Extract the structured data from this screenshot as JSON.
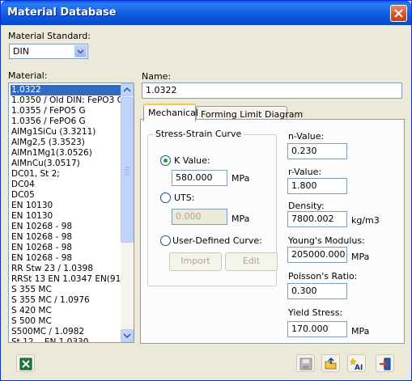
{
  "window": {
    "title": "Material Database"
  },
  "material_standard": {
    "label": "Material Standard:",
    "selected": "DIN"
  },
  "material_list": {
    "label": "Material:",
    "items": [
      "1.0322",
      "1.0350 / Old DIN: FePO3 G",
      "1.0355 / FePO5 G",
      "1.0356 / FePO6 G",
      "AlMg1SiCu (3.3211)",
      "AlMg2,5 (3.3523)",
      "AlMn1Mg1(3.0526)",
      "AlMnCu(3.0517)",
      "DC01, St 2;",
      "DC04",
      "DC05",
      "EN 10130",
      "EN 10130",
      "EN 10268 - 98",
      "EN 10268 - 98",
      "EN 10268 - 98",
      "EN 10268 - 98",
      "RR Stw 23 / 1.0398",
      "RRSt 13  EN 1.0347 EN(91)",
      "S 355 MC",
      "S 355 MC / 1.0976",
      "S 420 MC",
      "S 500 MC",
      "S500MC / 1.0982",
      "St 12 ...EN 1.0330"
    ],
    "selected_index": 0
  },
  "name_field": {
    "label": "Name:",
    "value": "1.0322"
  },
  "tabs": [
    {
      "label": "Mechanical",
      "active": true
    },
    {
      "label": "Forming Limit Diagram",
      "active": false
    }
  ],
  "stress_strain": {
    "title": "Stress-Strain Curve",
    "k_value": {
      "label": "K Value:",
      "value": "580.000",
      "unit": "MPa",
      "checked": true
    },
    "uts": {
      "label": "UTS:",
      "value": "0.000",
      "unit": "MPa",
      "checked": false
    },
    "user_defined": {
      "label": "User-Defined Curve:",
      "checked": false
    },
    "import_label": "Import",
    "edit_label": "Edit"
  },
  "properties": {
    "n_value": {
      "label": "n-Value:",
      "value": "0.230"
    },
    "r_value": {
      "label": "r-Value:",
      "value": "1.800"
    },
    "density": {
      "label": "Density:",
      "value": "7800.002",
      "unit": "kg/m3"
    },
    "youngs_modulus": {
      "label": "Young's Modulus:",
      "value": "205000.000",
      "unit": "MPa"
    },
    "poissons_ratio": {
      "label": "Poisson's Ratio:",
      "value": "0.300"
    },
    "yield_stress": {
      "label": "Yield Stress:",
      "value": "170.000",
      "unit": "MPa"
    }
  },
  "toolbar": {
    "excel_icon": "excel-icon",
    "save_icon": "floppy-disk-icon",
    "open_icon": "open-folder-icon",
    "new_icon": "new-material-icon",
    "exit_icon": "exit-door-icon",
    "new_text": "AI"
  },
  "colors": {
    "title_bar": "#0a5ddf",
    "selection": "#316ac5",
    "active_tab_accent": "#ffc83c"
  }
}
